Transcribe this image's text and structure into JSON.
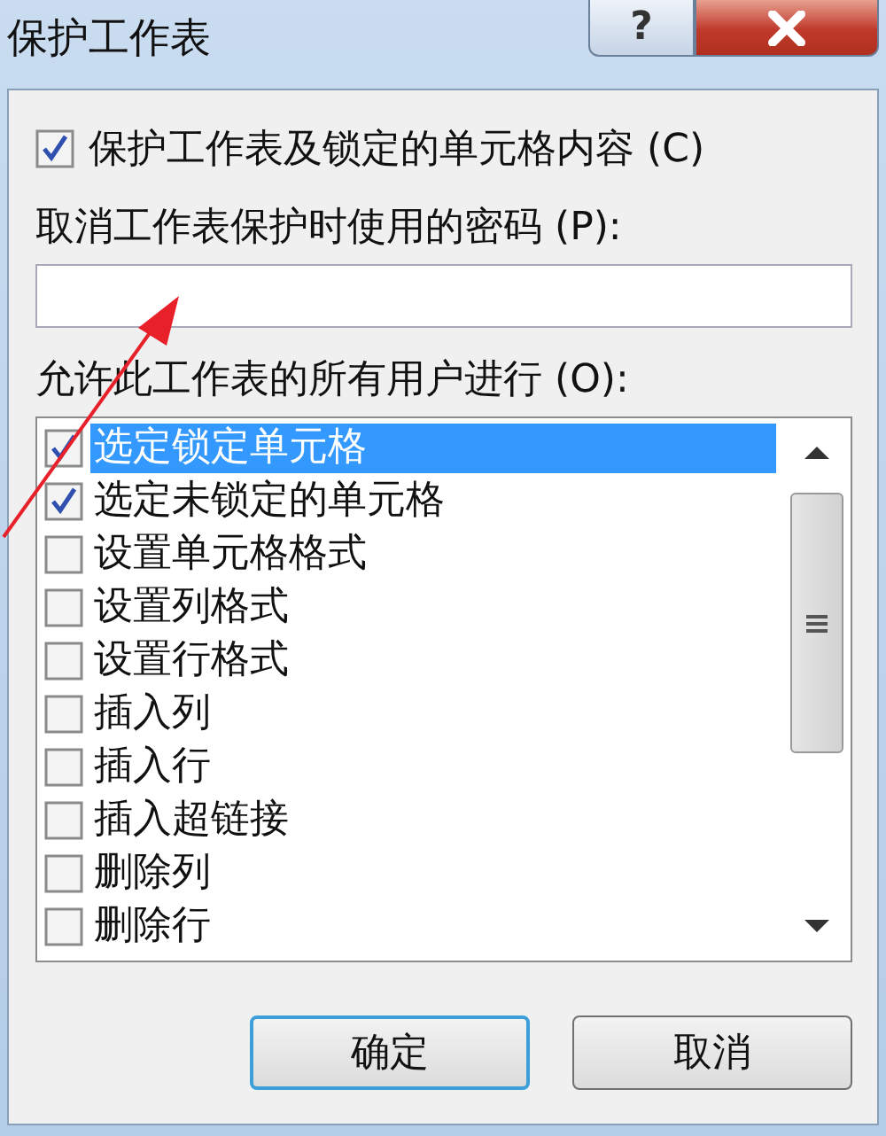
{
  "window": {
    "title": "保护工作表",
    "help_button": "?"
  },
  "protect": {
    "label": "保护工作表及锁定的单元格内容 (C)",
    "checked": true
  },
  "password": {
    "label": "取消工作表保护时使用的密码 (P):"
  },
  "permissions": {
    "label": "允许此工作表的所有用户进行 (O):",
    "items": [
      {
        "label": "选定锁定单元格",
        "checked": true,
        "selected": true
      },
      {
        "label": "选定未锁定的单元格",
        "checked": true,
        "selected": false
      },
      {
        "label": "设置单元格格式",
        "checked": false,
        "selected": false
      },
      {
        "label": "设置列格式",
        "checked": false,
        "selected": false
      },
      {
        "label": "设置行格式",
        "checked": false,
        "selected": false
      },
      {
        "label": "插入列",
        "checked": false,
        "selected": false
      },
      {
        "label": "插入行",
        "checked": false,
        "selected": false
      },
      {
        "label": "插入超链接",
        "checked": false,
        "selected": false
      },
      {
        "label": "删除列",
        "checked": false,
        "selected": false
      },
      {
        "label": "删除行",
        "checked": false,
        "selected": false
      }
    ]
  },
  "buttons": [
    {
      "label": "确定",
      "kind": "default"
    },
    {
      "label": "取消",
      "kind": "normal"
    }
  ]
}
